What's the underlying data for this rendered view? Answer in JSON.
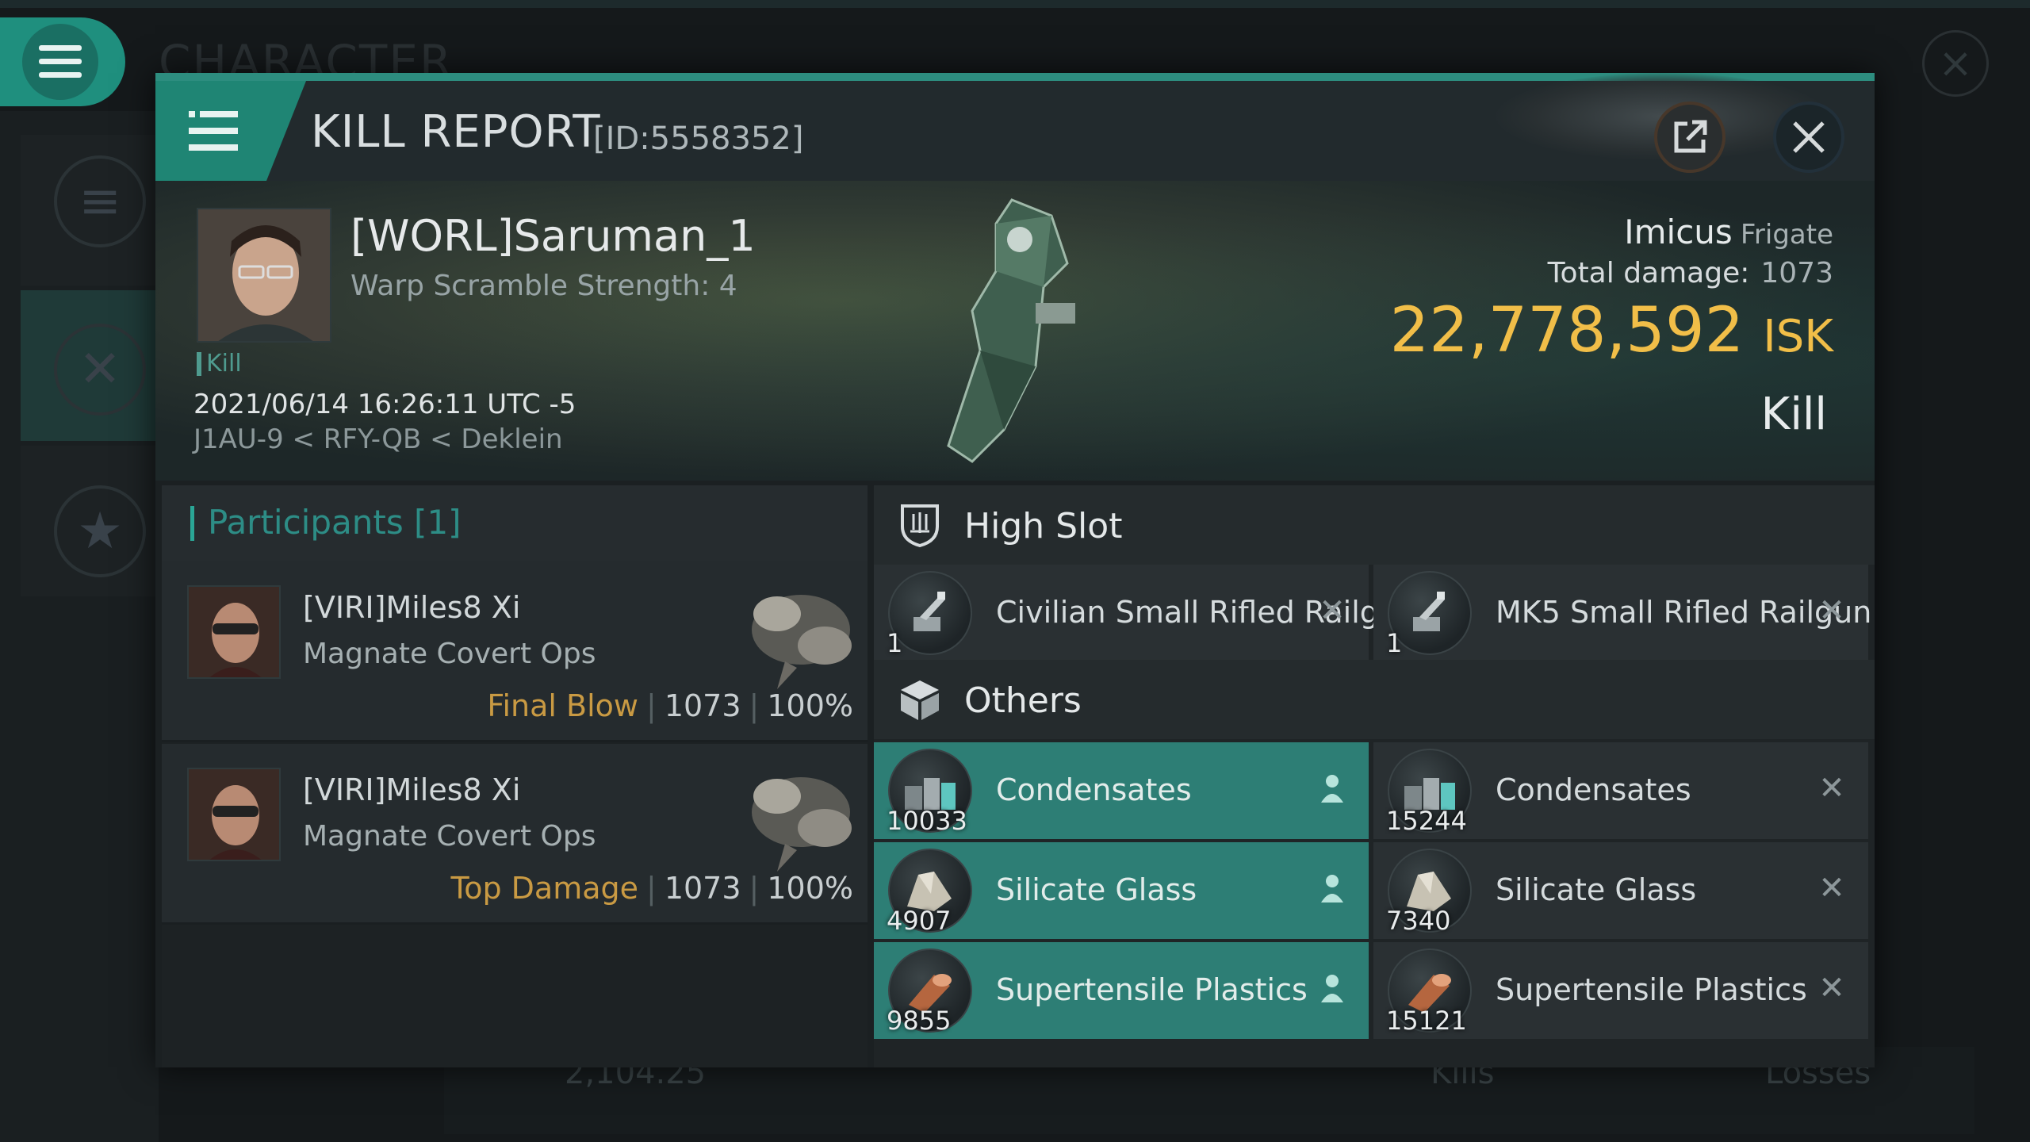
{
  "background": {
    "title": "CHARACTER",
    "bottom_value": "2,104.25",
    "bottom_kills": "Kills",
    "bottom_losses": "Losses"
  },
  "header": {
    "title": "KILL REPORT",
    "id": "[ID:5558352]"
  },
  "victim": {
    "name": "[WORL]Saruman_1",
    "scramble": "Warp Scramble Strength: 4",
    "tag": "Kill",
    "timestamp": "2021/06/14 16:26:11 UTC -5",
    "location": "J1AU-9 < RFY-QB < Deklein",
    "ship": "Imicus",
    "ship_class": "Frigate",
    "damage_label": "Total damage:",
    "damage": "1073",
    "isk": "22,778,592",
    "isk_unit": "ISK",
    "result": "Kill"
  },
  "participants": {
    "label": "Participants [1]",
    "rows": [
      {
        "name": "[VIRI]Miles8 Xi",
        "ship": "Magnate Covert Ops",
        "role": "Final Blow",
        "damage": "1073",
        "percent": "100%"
      },
      {
        "name": "[VIRI]Miles8 Xi",
        "ship": "Magnate Covert Ops",
        "role": "Top Damage",
        "damage": "1073",
        "percent": "100%"
      }
    ]
  },
  "sections": {
    "high_slot": "High Slot",
    "others": "Others"
  },
  "high_slot_items": [
    {
      "name": "Civilian Small Rifled Railgun",
      "qty": "1",
      "status": "destroyed"
    },
    {
      "name": "MK5 Small Rifled Railgun",
      "qty": "1",
      "status": "destroyed"
    }
  ],
  "other_items": [
    {
      "name": "Condensates",
      "qty": "10033",
      "status": "dropped"
    },
    {
      "name": "Condensates",
      "qty": "15244",
      "status": "destroyed"
    },
    {
      "name": "Silicate Glass",
      "qty": "4907",
      "status": "dropped"
    },
    {
      "name": "Silicate Glass",
      "qty": "7340",
      "status": "destroyed"
    },
    {
      "name": "Supertensile Plastics",
      "qty": "9855",
      "status": "dropped"
    },
    {
      "name": "Supertensile Plastics",
      "qty": "15121",
      "status": "destroyed"
    }
  ],
  "colors": {
    "accent": "#2d8d7f",
    "dropped": "#2d7e75",
    "isk": "#f1be48",
    "final_blow": "#c99a43"
  }
}
